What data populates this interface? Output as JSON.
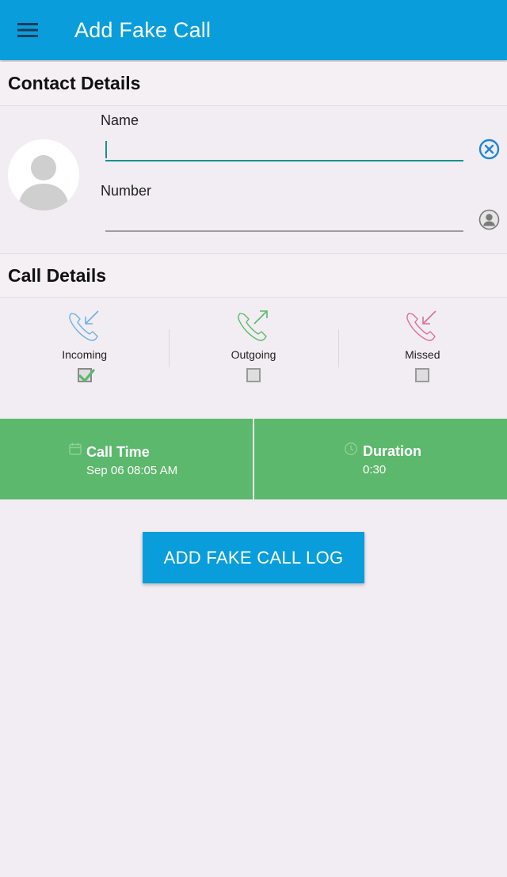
{
  "appbar": {
    "title": "Add Fake Call",
    "menu_icon": "hamburger-menu-icon",
    "background": "#0a9ddb"
  },
  "contact": {
    "header": "Contact Details",
    "name_label": "Name",
    "name_value": "",
    "number_label": "Number",
    "number_value": "",
    "avatar_icon": "person-placeholder-icon",
    "clear_icon": "clear-circle-icon",
    "contact_picker_icon": "contact-picker-icon"
  },
  "call": {
    "header": "Call Details",
    "types": [
      {
        "label": "Incoming",
        "checked": true,
        "icon": "incoming-call-icon",
        "color": "#6ab0e6"
      },
      {
        "label": "Outgoing",
        "checked": false,
        "icon": "outgoing-call-icon",
        "color": "#5cb86c"
      },
      {
        "label": "Missed",
        "checked": false,
        "icon": "missed-call-icon",
        "color": "#d9709a"
      }
    ]
  },
  "timing": {
    "call_time_label": "Call Time",
    "call_time_value": "Sep 06 08:05 AM",
    "duration_label": "Duration",
    "duration_value": "0:30",
    "background": "#5cb86c"
  },
  "actions": {
    "add_button_label": "ADD FAKE CALL LOG"
  }
}
